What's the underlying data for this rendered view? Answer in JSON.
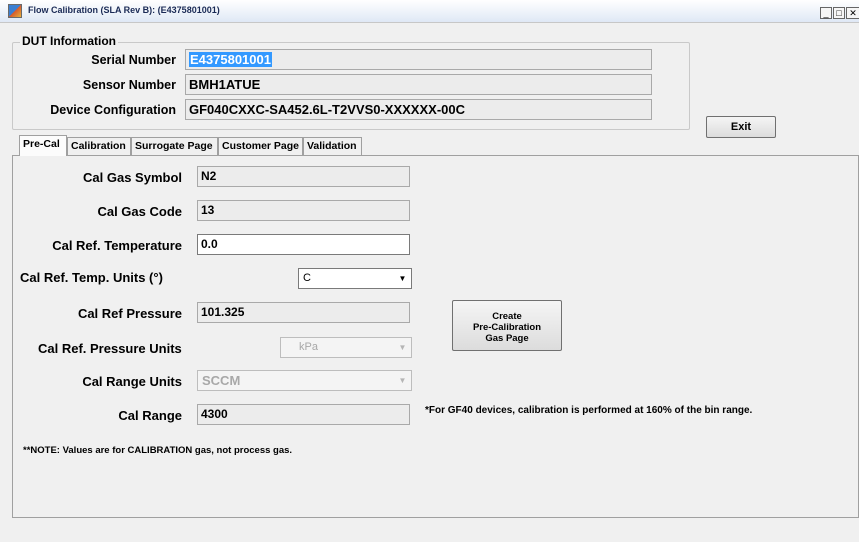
{
  "window": {
    "title": "Flow Calibration (SLA Rev B): (E4375801001)",
    "minimize": "_",
    "maximize": "□",
    "close": "✕"
  },
  "dut": {
    "legend": "DUT Information",
    "serial_label": "Serial Number",
    "serial_value": "E4375801001",
    "sensor_label": "Sensor Number",
    "sensor_value": "BMH1ATUE",
    "config_label": "Device Configuration",
    "config_value": "GF040CXXC-SA452.6L-T2VVS0-XXXXXX-00C"
  },
  "exit_label": "Exit",
  "tabs": [
    {
      "label": "Pre-Cal",
      "active": true
    },
    {
      "label": "Calibration",
      "active": false
    },
    {
      "label": "Surrogate Page",
      "active": false
    },
    {
      "label": "Customer Page",
      "active": false
    },
    {
      "label": "Validation",
      "active": false
    }
  ],
  "precal": {
    "gas_symbol_label": "Cal Gas Symbol",
    "gas_symbol_value": "N2",
    "gas_code_label": "Cal Gas Code",
    "gas_code_value": "13",
    "ref_temp_label": "Cal Ref. Temperature",
    "ref_temp_value": "0.0",
    "temp_units_label": "Cal Ref. Temp. Units (°)",
    "temp_units_value": "C",
    "ref_pressure_label": "Cal Ref Pressure",
    "ref_pressure_value": "101.325",
    "pressure_units_label": "Cal Ref. Pressure Units",
    "pressure_units_value": "kPa",
    "range_units_label": "Cal Range Units",
    "range_units_value": "SCCM",
    "range_label": "Cal Range",
    "range_value": "4300",
    "create_button_line1": "Create",
    "create_button_line2": "Pre-Calibration",
    "create_button_line3": "Gas Page",
    "gf40_note": "*For GF40 devices, calibration is performed at 160% of the bin range.",
    "note": "**NOTE: Values are for CALIBRATION gas, not process gas."
  },
  "colors": {
    "selection": "#3399ff",
    "background": "#f0f0f0",
    "title_text": "#1a2a55"
  }
}
